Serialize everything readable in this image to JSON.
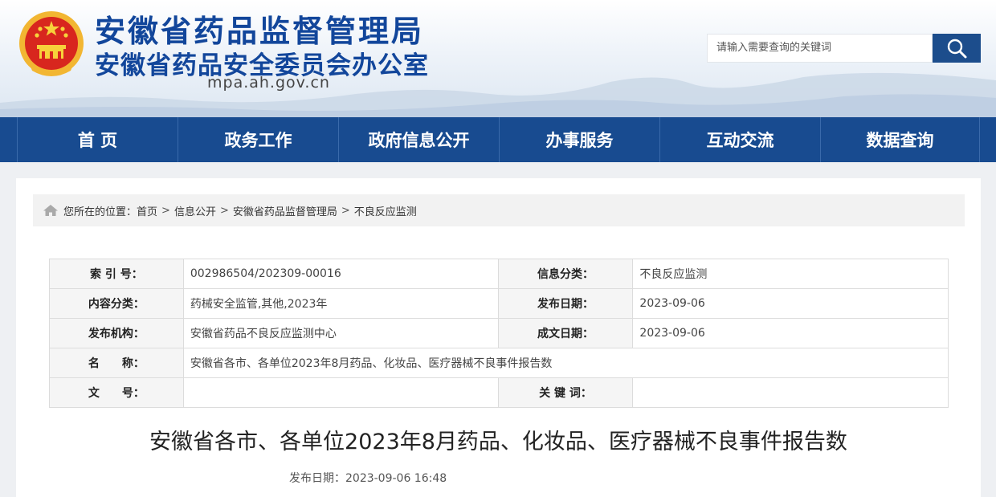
{
  "header": {
    "title_main": "安徽省药品监督管理局",
    "title_sub": "安徽省药品安全委员会办公室",
    "domain": "mpa.ah.gov.cn",
    "emblem_icon": "national-emblem-icon"
  },
  "search": {
    "placeholder": "请输入需要查询的关键词",
    "button_icon": "search-icon"
  },
  "nav": {
    "items": [
      "首 页",
      "政务工作",
      "政府信息公开",
      "办事服务",
      "互动交流",
      "数据查询"
    ]
  },
  "breadcrumb": {
    "prefix": "您所在的位置：",
    "items": [
      "首页",
      "信息公开",
      "安徽省药品监督管理局",
      "不良反应监测"
    ],
    "separator": ">"
  },
  "meta": {
    "index_label": "索 引 号：",
    "index_value": "002986504/202309-00016",
    "category_label": "信息分类：",
    "category_value": "不良反应监测",
    "content_label": "内容分类：",
    "content_value": "药械安全监管,其他,2023年",
    "pubdate_label": "发布日期：",
    "pubdate_value": "2023-09-06",
    "org_label": "发布机构：",
    "org_value": "安徽省药品不良反应监测中心",
    "created_label": "成文日期：",
    "created_value": "2023-09-06",
    "name_label": "名　　称：",
    "name_value": "安徽省各市、各单位2023年8月药品、化妆品、医疗器械不良事件报告数",
    "docno_label": "文　　号：",
    "docno_value": "",
    "keyword_label": "关 键 词：",
    "keyword_value": ""
  },
  "article": {
    "title": "安徽省各市、各单位2023年8月药品、化妆品、医疗器械不良事件报告数",
    "date_line": "发布日期：2023-09-06 16:48"
  },
  "colors": {
    "brand_blue": "#12469b",
    "nav_blue": "#184b90",
    "search_button": "#1c4d8c"
  }
}
